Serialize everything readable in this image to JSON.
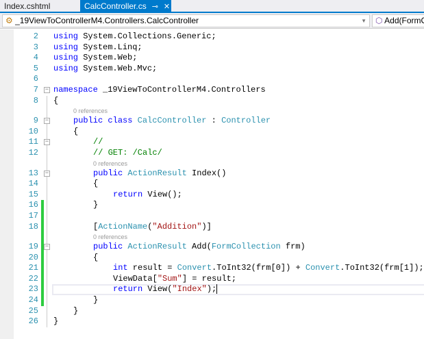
{
  "tabs": [
    {
      "label": "Index.cshtml",
      "active": false
    },
    {
      "label": "CalcController.cs",
      "active": true,
      "pin_icon": "pin-icon",
      "close_icon": "close-icon"
    }
  ],
  "nav": {
    "class_path": "_19ViewToControllerM4.Controllers.CalcController",
    "member": "Add(FormC"
  },
  "colors": {
    "accent": "#007acc",
    "keyword": "#0000ff",
    "type": "#2b91af",
    "string": "#a31515",
    "comment": "#008000",
    "change": "#2ecc40"
  },
  "lens_text": "0 references",
  "lines": [
    {
      "n": "2",
      "indent": 0,
      "t": [
        [
          "kw",
          "using"
        ],
        [
          "plain",
          " System.Collections.Generic;"
        ]
      ]
    },
    {
      "n": "3",
      "indent": 0,
      "t": [
        [
          "kw",
          "using"
        ],
        [
          "plain",
          " System.Linq;"
        ]
      ]
    },
    {
      "n": "4",
      "indent": 0,
      "t": [
        [
          "kw",
          "using"
        ],
        [
          "plain",
          " System.Web;"
        ]
      ]
    },
    {
      "n": "5",
      "indent": 0,
      "t": [
        [
          "kw",
          "using"
        ],
        [
          "plain",
          " System.Web.Mvc;"
        ]
      ]
    },
    {
      "n": "6",
      "indent": 0,
      "t": []
    },
    {
      "n": "7",
      "indent": 0,
      "fold": true,
      "t": [
        [
          "kw",
          "namespace"
        ],
        [
          "plain",
          " _19ViewToControllerM4.Controllers"
        ]
      ]
    },
    {
      "n": "8",
      "indent": 0,
      "t": [
        [
          "plain",
          "{"
        ]
      ]
    },
    {
      "lens": true,
      "indent": 1
    },
    {
      "n": "9",
      "indent": 1,
      "fold": true,
      "t": [
        [
          "kw",
          "public"
        ],
        [
          "plain",
          " "
        ],
        [
          "kw",
          "class"
        ],
        [
          "plain",
          " "
        ],
        [
          "type",
          "CalcController"
        ],
        [
          "plain",
          " : "
        ],
        [
          "type",
          "Controller"
        ]
      ]
    },
    {
      "n": "10",
      "indent": 1,
      "t": [
        [
          "plain",
          "{"
        ]
      ]
    },
    {
      "n": "11",
      "indent": 2,
      "fold": true,
      "t": [
        [
          "cmt",
          "//"
        ]
      ]
    },
    {
      "n": "12",
      "indent": 2,
      "t": [
        [
          "cmt",
          "// GET: /Calc/"
        ]
      ]
    },
    {
      "lens": true,
      "indent": 2
    },
    {
      "n": "13",
      "indent": 2,
      "fold": true,
      "t": [
        [
          "kw",
          "public"
        ],
        [
          "plain",
          " "
        ],
        [
          "type",
          "ActionResult"
        ],
        [
          "plain",
          " Index()"
        ]
      ]
    },
    {
      "n": "14",
      "indent": 2,
      "t": [
        [
          "plain",
          "{"
        ]
      ]
    },
    {
      "n": "15",
      "indent": 3,
      "t": [
        [
          "kw",
          "return"
        ],
        [
          "plain",
          " View();"
        ]
      ]
    },
    {
      "n": "16",
      "indent": 2,
      "chg": true,
      "t": [
        [
          "plain",
          "}"
        ]
      ]
    },
    {
      "n": "17",
      "indent": 0,
      "chg": true,
      "t": []
    },
    {
      "n": "18",
      "indent": 2,
      "chg": true,
      "t": [
        [
          "plain",
          "["
        ],
        [
          "type",
          "ActionName"
        ],
        [
          "plain",
          "("
        ],
        [
          "str",
          "\"Addition\""
        ],
        [
          "plain",
          ")]"
        ]
      ]
    },
    {
      "lens": true,
      "indent": 2,
      "chg": true
    },
    {
      "n": "19",
      "indent": 2,
      "chg": true,
      "fold": true,
      "t": [
        [
          "kw",
          "public"
        ],
        [
          "plain",
          " "
        ],
        [
          "type",
          "ActionResult"
        ],
        [
          "plain",
          " Add("
        ],
        [
          "type",
          "FormCollection"
        ],
        [
          "plain",
          " frm)"
        ]
      ]
    },
    {
      "n": "20",
      "indent": 2,
      "chg": true,
      "t": [
        [
          "plain",
          "{"
        ]
      ]
    },
    {
      "n": "21",
      "indent": 3,
      "chg": true,
      "t": [
        [
          "kw",
          "int"
        ],
        [
          "plain",
          " result = "
        ],
        [
          "type",
          "Convert"
        ],
        [
          "plain",
          ".ToInt32(frm[0]) + "
        ],
        [
          "type",
          "Convert"
        ],
        [
          "plain",
          ".ToInt32(frm[1]);"
        ]
      ]
    },
    {
      "n": "22",
      "indent": 3,
      "chg": true,
      "t": [
        [
          "plain",
          "ViewData["
        ],
        [
          "str",
          "\"Sum\""
        ],
        [
          "plain",
          "] = result;"
        ]
      ]
    },
    {
      "n": "23",
      "indent": 3,
      "chg": true,
      "cur": true,
      "t": [
        [
          "kw",
          "return"
        ],
        [
          "plain",
          " View("
        ],
        [
          "str",
          "\"Index\""
        ],
        [
          "plain",
          ");"
        ]
      ]
    },
    {
      "n": "24",
      "indent": 2,
      "chg": true,
      "t": [
        [
          "plain",
          "}"
        ]
      ]
    },
    {
      "n": "25",
      "indent": 1,
      "t": [
        [
          "plain",
          "}"
        ]
      ]
    },
    {
      "n": "26",
      "indent": 0,
      "t": [
        [
          "plain",
          "}"
        ]
      ]
    }
  ]
}
